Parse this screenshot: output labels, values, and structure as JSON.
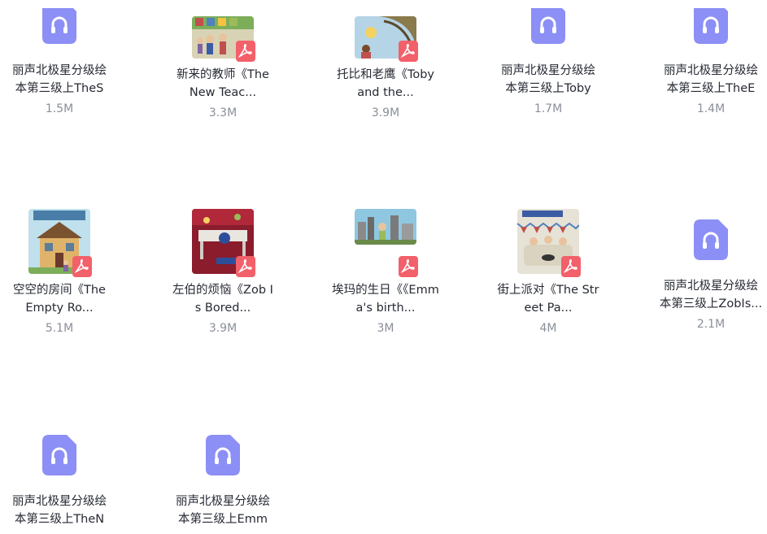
{
  "files": [
    {
      "name_l1": "丽声北极星分级绘",
      "name_l2": "本第三级上TheS",
      "size": "1.5M",
      "kind": "audio"
    },
    {
      "name_l1": "新来的教师《The",
      "name_l2": "New Teac...",
      "size": "3.3M",
      "kind": "pdf"
    },
    {
      "name_l1": "托比和老鹰《Toby",
      "name_l2": "and the...",
      "size": "3.9M",
      "kind": "pdf"
    },
    {
      "name_l1": "丽声北极星分级绘",
      "name_l2": "本第三级上Toby",
      "size": "1.7M",
      "kind": "audio"
    },
    {
      "name_l1": "丽声北极星分级绘",
      "name_l2": "本第三级上TheE",
      "size": "1.4M",
      "kind": "audio"
    },
    {
      "name_l1": "空空的房间《The",
      "name_l2": "Empty Ro...",
      "size": "5.1M",
      "kind": "pdf"
    },
    {
      "name_l1": "左伯的烦恼《Zob I",
      "name_l2": "s Bored...",
      "size": "3.9M",
      "kind": "pdf"
    },
    {
      "name_l1": "埃玛的生日《《Emm",
      "name_l2": "a's birth...",
      "size": "3M",
      "kind": "pdf"
    },
    {
      "name_l1": "街上派对《The Str",
      "name_l2": "eet Pa...",
      "size": "4M",
      "kind": "pdf"
    },
    {
      "name_l1": "丽声北极星分级绘",
      "name_l2": "本第三级上ZobIs...",
      "size": "2.1M",
      "kind": "audio"
    },
    {
      "name_l1": "丽声北极星分级绘",
      "name_l2": "本第三级上TheN",
      "size": "",
      "kind": "audio"
    },
    {
      "name_l1": "丽声北极星分级绘",
      "name_l2": "本第三级上Emm",
      "size": "",
      "kind": "audio"
    }
  ],
  "colors": {
    "audio_icon": "#8c8ff5",
    "pdf_badge": "#f2606a",
    "title_text": "#262a33",
    "size_text": "#8a8f99"
  },
  "icons": {
    "audio": "headphones-icon",
    "pdf": "pdf-icon"
  }
}
